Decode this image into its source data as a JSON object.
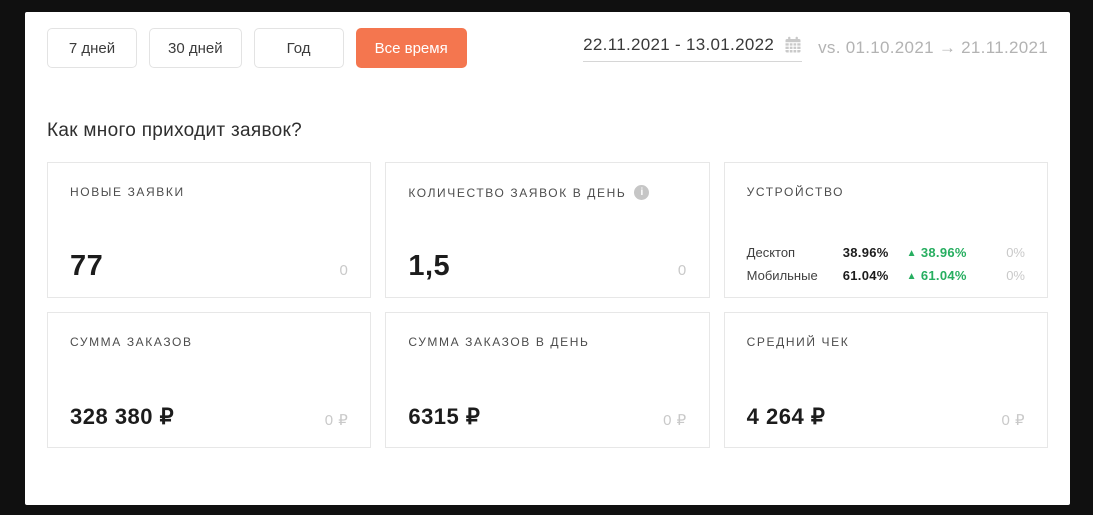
{
  "accent": {
    "orange": "#f4764f",
    "green": "#27ae60"
  },
  "toolbar": {
    "buttons": [
      {
        "label": "7 дней",
        "active": false
      },
      {
        "label": "30 дней",
        "active": false
      },
      {
        "label": "Год",
        "active": false
      },
      {
        "label": "Все время",
        "active": true
      }
    ],
    "date_range": "22.11.2021 - 13.01.2022",
    "comparison": "vs. 01.10.2021 → 21.11.2021"
  },
  "section": {
    "title": "Как много приходит заявок?"
  },
  "cards": {
    "new_requests": {
      "title": "НОВЫЕ ЗАЯВКИ",
      "value": "77",
      "compare": "0"
    },
    "requests_per_day": {
      "title": "КОЛИЧЕСТВО ЗАЯВОК В ДЕНЬ",
      "value": "1,5",
      "compare": "0"
    },
    "device": {
      "title": "УСТРОЙСТВО",
      "rows": [
        {
          "label": "Десктоп",
          "value": "38.96%",
          "delta": "38.96%",
          "compare": "0%"
        },
        {
          "label": "Мобильные",
          "value": "61.04%",
          "delta": "61.04%",
          "compare": "0%"
        }
      ]
    },
    "orders_sum": {
      "title": "СУММА ЗАКАЗОВ",
      "value": "328 380 ₽",
      "compare": "0 ₽"
    },
    "orders_per_day": {
      "title": "СУММА ЗАКАЗОВ В ДЕНЬ",
      "value": "6315 ₽",
      "compare": "0 ₽"
    },
    "avg_check": {
      "title": "СРЕДНИЙ ЧЕК",
      "value": "4 264 ₽",
      "compare": "0 ₽"
    }
  },
  "icons": {
    "up_arrow": "▲",
    "info": "i"
  }
}
